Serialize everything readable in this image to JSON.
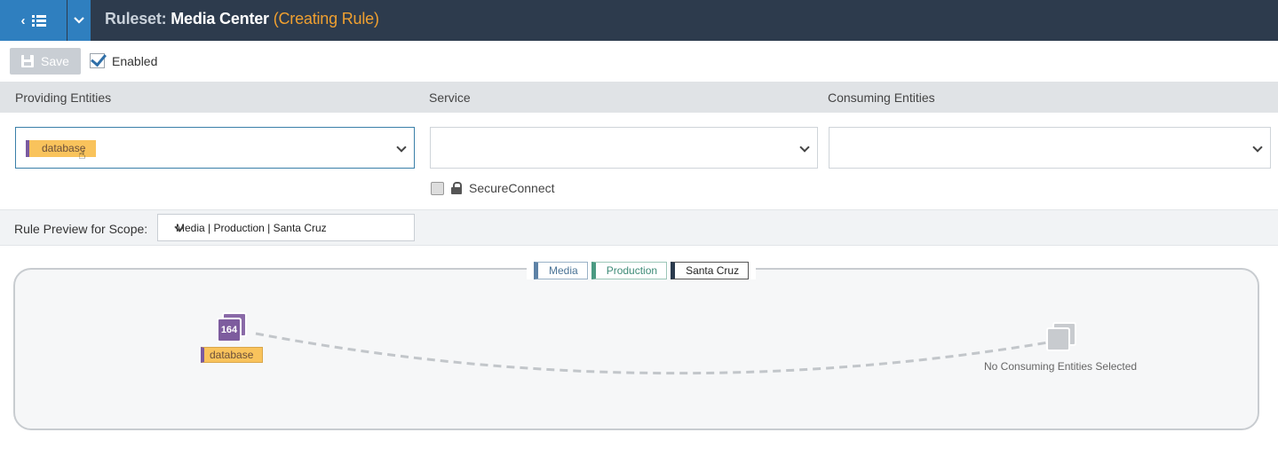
{
  "header": {
    "label": "Ruleset:",
    "name": "Media Center",
    "status": "(Creating Rule)"
  },
  "toolbar": {
    "save_label": "Save",
    "enabled_label": "Enabled",
    "enabled_checked": true
  },
  "columns": {
    "providing": "Providing Entities",
    "service": "Service",
    "consuming": "Consuming Entities"
  },
  "providing_select": {
    "tag": "database"
  },
  "service_select": {
    "value": ""
  },
  "consuming_select": {
    "value": ""
  },
  "secure_connect": {
    "label": "SecureConnect",
    "checked": false
  },
  "scope": {
    "label": "Rule Preview for Scope:",
    "value": "Media | Production | Santa Cruz"
  },
  "preview": {
    "legend": [
      "Media",
      "Production",
      "Santa Cruz"
    ],
    "provider_count": "164",
    "provider_tag": "database",
    "consumer_empty": "No Consuming Entities Selected"
  },
  "colors": {
    "topbar": "#2d3b4d",
    "accent": "#2f7fbf",
    "status": "#f0a030",
    "db_tag": "#f9c35c",
    "db_tag_edge": "#7a5aa0"
  }
}
